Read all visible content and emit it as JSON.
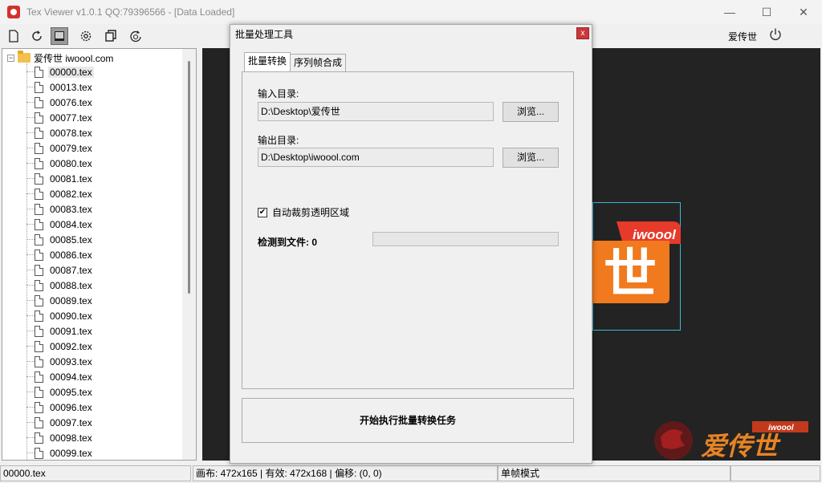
{
  "window": {
    "title": "Tex Viewer v1.0.1 QQ:79396566 - [Data Loaded]",
    "minimize_glyph": "—",
    "maximize_glyph": "☐",
    "close_glyph": "✕"
  },
  "toolbar": {
    "icons": [
      "new-file-icon",
      "refresh-icon",
      "view-mode-icon",
      "settings-icon",
      "copy-icon",
      "history-icon"
    ],
    "user_name": "爱传世"
  },
  "tree": {
    "root_label": "爱传世 iwoool.com",
    "expander": "−",
    "files": [
      "00000.tex",
      "00013.tex",
      "00076.tex",
      "00077.tex",
      "00078.tex",
      "00079.tex",
      "00080.tex",
      "00081.tex",
      "00082.tex",
      "00083.tex",
      "00084.tex",
      "00085.tex",
      "00086.tex",
      "00087.tex",
      "00088.tex",
      "00089.tex",
      "00090.tex",
      "00091.tex",
      "00092.tex",
      "00093.tex",
      "00094.tex",
      "00095.tex",
      "00096.tex",
      "00097.tex",
      "00098.tex",
      "00099.tex"
    ],
    "selected_index": 0
  },
  "canvas": {
    "background": "#232323",
    "bound_color": "#3fb6d0",
    "logo_text": "iwoool",
    "logo_glyph": "世",
    "watermark_text": "爱传世",
    "watermark_tag": "iwoool"
  },
  "status": {
    "file": "00000.tex",
    "info": "画布: 472x165 | 有效: 472x168 | 偏移: (0, 0)",
    "mode": "单帧模式"
  },
  "dialog": {
    "title": "批量处理工具",
    "close_glyph": "x",
    "tabs": [
      "批量转换",
      "序列帧合成"
    ],
    "input_label": "输入目录:",
    "input_value": "D:\\Desktop\\爱传世",
    "output_label": "输出目录:",
    "output_value": "D:\\Desktop\\iwoool.com",
    "browse_label": "浏览...",
    "checkbox_label": "自动裁剪透明区域",
    "checkbox_mark": "✔",
    "detect_label": "检测到文件: 0",
    "progress": 0,
    "start_label": "开始执行批量转换任务"
  }
}
